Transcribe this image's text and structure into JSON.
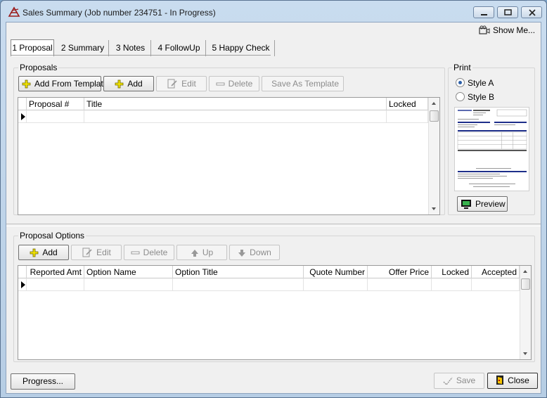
{
  "window": {
    "title": "Sales Summary  (Job number 234751 - In Progress)"
  },
  "header": {
    "show_me_label": "Show Me..."
  },
  "tabs": [
    {
      "label": "1 Proposal",
      "active": true
    },
    {
      "label": "2 Summary",
      "active": false
    },
    {
      "label": "3 Notes",
      "active": false
    },
    {
      "label": "4 FollowUp",
      "active": false
    },
    {
      "label": "5 Happy Check",
      "active": false
    }
  ],
  "proposals": {
    "group_label": "Proposals",
    "toolbar": {
      "add_from_template": "Add From Template",
      "add": "Add",
      "edit": "Edit",
      "delete": "Delete",
      "save_as_template": "Save As Template"
    },
    "columns": [
      "Proposal #",
      "Title",
      "Locked"
    ]
  },
  "print": {
    "group_label": "Print",
    "style_a": "Style A",
    "style_b": "Style B",
    "selected": "Style A",
    "preview_label": "Preview"
  },
  "proposal_options": {
    "group_label": "Proposal Options",
    "toolbar": {
      "add": "Add",
      "edit": "Edit",
      "delete": "Delete",
      "up": "Up",
      "down": "Down"
    },
    "columns": [
      "Reported Amt",
      "Option Name",
      "Option Title",
      "Quote Number",
      "Offer Price",
      "Locked",
      "Accepted"
    ]
  },
  "footer": {
    "progress_label": "Progress...",
    "save_label": "Save",
    "close_label": "Close"
  },
  "colors": {
    "titlebar": "#c9dcef",
    "radio_dot": "#2b5fa8",
    "add_icon": "#f2e400"
  }
}
